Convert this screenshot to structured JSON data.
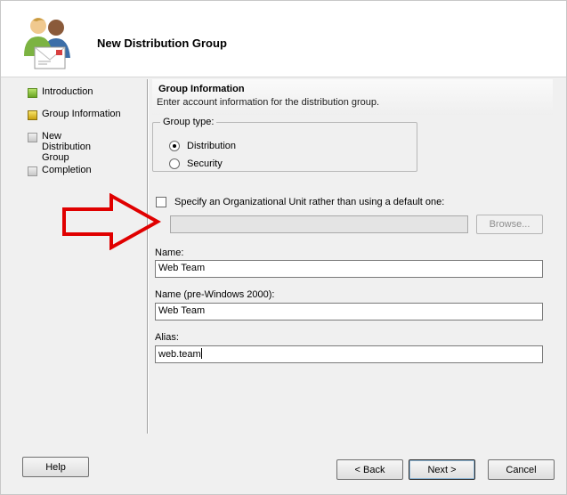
{
  "window": {
    "title": "New Distribution Group"
  },
  "nav": {
    "items": [
      {
        "label": "Introduction",
        "state": "complete"
      },
      {
        "label": "Group Information",
        "state": "current"
      },
      {
        "label": "New Distribution Group",
        "state": "pending"
      },
      {
        "label": "Completion",
        "state": "pending"
      }
    ]
  },
  "section": {
    "title": "Group Information",
    "description": "Enter account information for the distribution group."
  },
  "group_type": {
    "legend": "Group type:",
    "options": [
      {
        "label": "Distribution",
        "checked": true
      },
      {
        "label": "Security",
        "checked": false
      }
    ]
  },
  "ou": {
    "checkbox_label": "Specify an Organizational Unit rather than using a default one:",
    "checked": false,
    "value": "",
    "browse_label": "Browse..."
  },
  "fields": {
    "name_label": "Name:",
    "name_value": "Web Team",
    "pre2000_label": "Name (pre-Windows 2000):",
    "pre2000_value": "Web Team",
    "alias_label": "Alias:",
    "alias_value": "web.team"
  },
  "buttons": {
    "help": "Help",
    "back": "< Back",
    "next": "Next >",
    "cancel": "Cancel"
  },
  "colors": {
    "arrow": "#e00000",
    "complete": "#6aa423",
    "current": "#c9a10f"
  },
  "icons": {
    "header": "users-mail-icon",
    "annotation": "right-arrow-icon"
  }
}
